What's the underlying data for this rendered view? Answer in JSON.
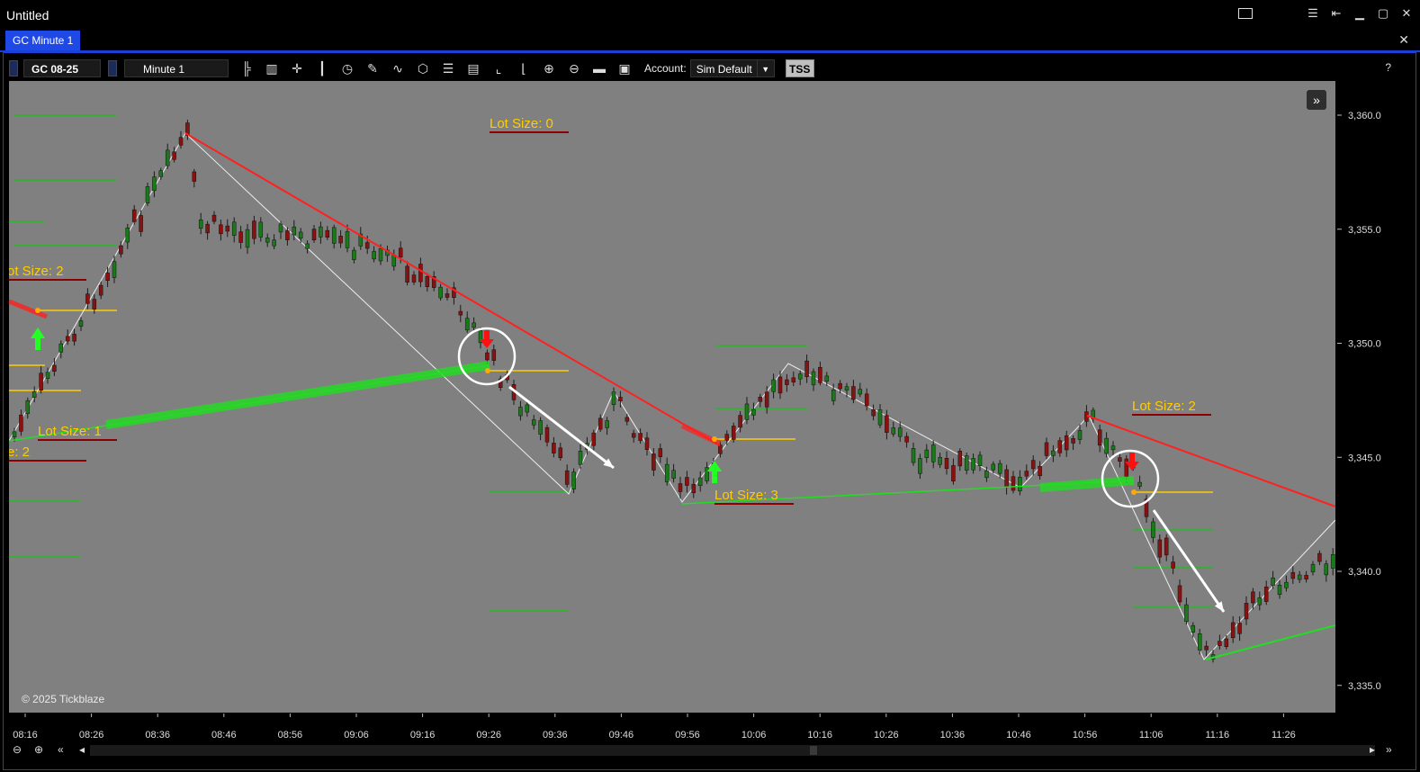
{
  "app": {
    "title": "Untitled"
  },
  "tab": {
    "label": "GC Minute 1"
  },
  "toolbar": {
    "instrument": "GC 08-25",
    "timeframe": "Minute 1",
    "account_label": "Account:",
    "account_value": "Sim Default",
    "tss_label": "TSS",
    "help": "?"
  },
  "chart": {
    "copyright": "© 2025 Tickblaze",
    "y_ticks": [
      "3,360.0",
      "3,355.0",
      "3,350.0",
      "3,345.0",
      "3,340.0",
      "3,335.0"
    ],
    "x_ticks": [
      "08:16",
      "08:26",
      "08:36",
      "08:46",
      "08:56",
      "09:06",
      "09:16",
      "09:26",
      "09:36",
      "09:46",
      "09:56",
      "10:06",
      "10:16",
      "10:26",
      "10:36",
      "10:46",
      "10:56",
      "11:06",
      "11:16",
      "11:26"
    ],
    "lot_labels": [
      "Lot Size: 0",
      "ot Size: 2",
      "Lot Size: 1",
      "e: 2",
      "Lot Size: 3",
      "Lot Size: 2"
    ],
    "colors": {
      "background": "#808080",
      "up": "#1a7a1a",
      "down": "#8b1010",
      "trend_down": "#ff2020",
      "trend_up": "#22dd22",
      "entry": "#ffcc00"
    }
  }
}
